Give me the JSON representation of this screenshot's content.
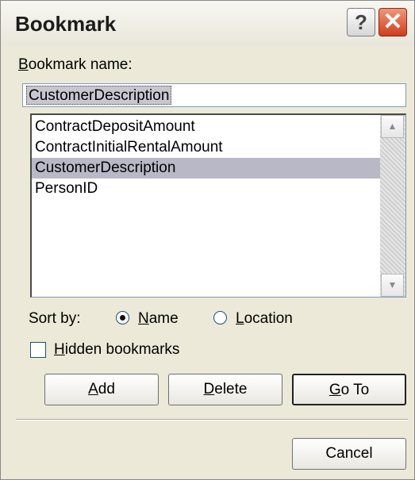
{
  "window": {
    "title": "Bookmark",
    "help_glyph": "?",
    "close_glyph": "✕"
  },
  "bookmark_name": {
    "label_accesskey": "B",
    "label_rest": "ookmark name:",
    "value": "CustomerDescription"
  },
  "bookmark_list": {
    "items": [
      "ContractDepositAmount",
      "ContractInitialRentalAmount",
      "CustomerDescription",
      "PersonID"
    ],
    "selected_index": 2
  },
  "sort": {
    "label": "Sort by:",
    "name": {
      "accesskey": "N",
      "rest": "ame",
      "selected": true
    },
    "location": {
      "accesskey": "L",
      "rest": "ocation",
      "selected": false
    }
  },
  "hidden_bookmarks": {
    "accesskey": "H",
    "rest": "idden bookmarks",
    "checked": false
  },
  "buttons": {
    "add": {
      "accesskey": "A",
      "rest": "dd"
    },
    "delete": {
      "accesskey": "D",
      "rest": "elete"
    },
    "goto": {
      "accesskey": "G",
      "rest": "o To"
    },
    "cancel": "Cancel"
  },
  "icons": [
    "help-icon",
    "close-icon",
    "scroll-up-arrow-icon",
    "scroll-down-arrow-icon"
  ]
}
